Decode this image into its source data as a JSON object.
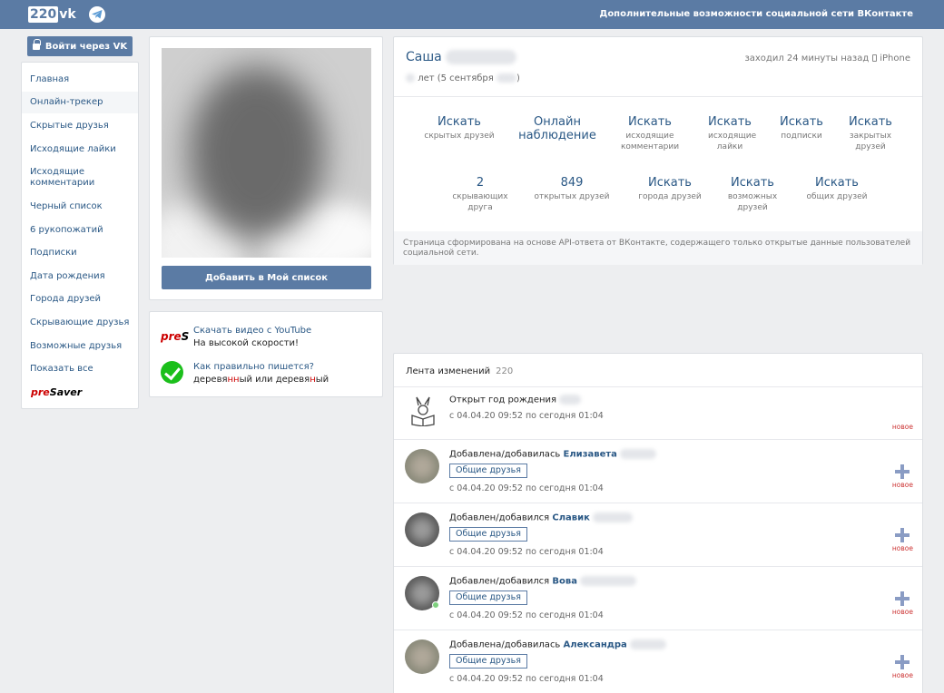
{
  "header": {
    "logo_box": "220",
    "logo_vk": "vk",
    "tagline": "Дополнительные возможности социальной сети ВКонтакте"
  },
  "login": {
    "label": "Войти через VK"
  },
  "sidebar": {
    "items": [
      {
        "label": "Главная"
      },
      {
        "label": "Онлайн-трекер"
      },
      {
        "label": "Скрытые друзья"
      },
      {
        "label": "Исходящие лайки"
      },
      {
        "label": "Исходящие комментарии"
      },
      {
        "label": "Черный список"
      },
      {
        "label": "6 рукопожатий"
      },
      {
        "label": "Подписки"
      },
      {
        "label": "Дата рождения"
      },
      {
        "label": "Города друзей"
      },
      {
        "label": "Скрывающие друзья"
      },
      {
        "label": "Возможные друзья"
      },
      {
        "label": "Показать все"
      }
    ],
    "presaver_pre": "pre",
    "presaver_rest": "Saver"
  },
  "photo_card": {
    "add_button": "Добавить в Мой список"
  },
  "ads": {
    "yt_icon_a": "pre",
    "yt_icon_b": "S",
    "yt_line1": "Скачать видео с YouTube",
    "yt_line2": "На высокой скорости!",
    "spell_line1": "Как правильно пишется?",
    "spell_a": "деревя",
    "spell_b": "нн",
    "spell_c": "ый или деревя",
    "spell_d": "н",
    "spell_e": "ый"
  },
  "profile": {
    "name": "Саша",
    "age_suffix": "лет (5 сентября",
    "age_close": ")",
    "last_seen": "заходил 24 минуты назад",
    "device": "iPhone",
    "stats_row1": [
      {
        "big": "Искать",
        "small": "скрытых друзей"
      },
      {
        "big": "Онлайн наблюдение",
        "small": ""
      },
      {
        "big": "Искать",
        "small": "исходящие комментарии"
      },
      {
        "big": "Искать",
        "small": "исходящие лайки"
      },
      {
        "big": "Искать",
        "small": "подписки"
      },
      {
        "big": "Искать",
        "small": "закрытых друзей"
      }
    ],
    "stats_row2": [
      {
        "big": "2",
        "small": "скрывающих друга"
      },
      {
        "big": "849",
        "small": "открытых друзей"
      },
      {
        "big": "Искать",
        "small": "города друзей"
      },
      {
        "big": "Искать",
        "small": "возможных друзей"
      },
      {
        "big": "Искать",
        "small": "общих друзей"
      }
    ],
    "note": "Страница сформирована на основе API-ответа от ВКонтакте, содержащего только открытые данные пользователей социальной сети."
  },
  "feed": {
    "title": "Лента изменений",
    "count": "220",
    "items": [
      {
        "text": "Открыт год рождения",
        "name": "",
        "time": "с 04.04.20 09:52 по сегодня 01:04",
        "badge": "новое"
      },
      {
        "text": "Добавлена/добавилась",
        "name": "Елизавета",
        "button": "Общие друзья",
        "time": "с 04.04.20 09:52 по сегодня 01:04",
        "badge": "новое"
      },
      {
        "text": "Добавлен/добавился",
        "name": "Славик",
        "button": "Общие друзья",
        "time": "с 04.04.20 09:52 по сегодня 01:04",
        "badge": "новое"
      },
      {
        "text": "Добавлен/добавился",
        "name": "Вова",
        "button": "Общие друзья",
        "time": "с 04.04.20 09:52 по сегодня 01:04",
        "badge": "новое"
      },
      {
        "text": "Добавлена/добавилась",
        "name": "Александра",
        "button": "Общие друзья",
        "time": "с 04.04.20 09:52 по сегодня 01:04",
        "badge": "новое"
      }
    ]
  },
  "colors": {
    "brand": "#5b7ba4",
    "link": "#2a5885",
    "new_badge": "#c33"
  },
  "icons": [
    "telegram-icon",
    "lock-icon",
    "checkmark-icon",
    "book-icon",
    "plus-icon",
    "phone-icon"
  ]
}
